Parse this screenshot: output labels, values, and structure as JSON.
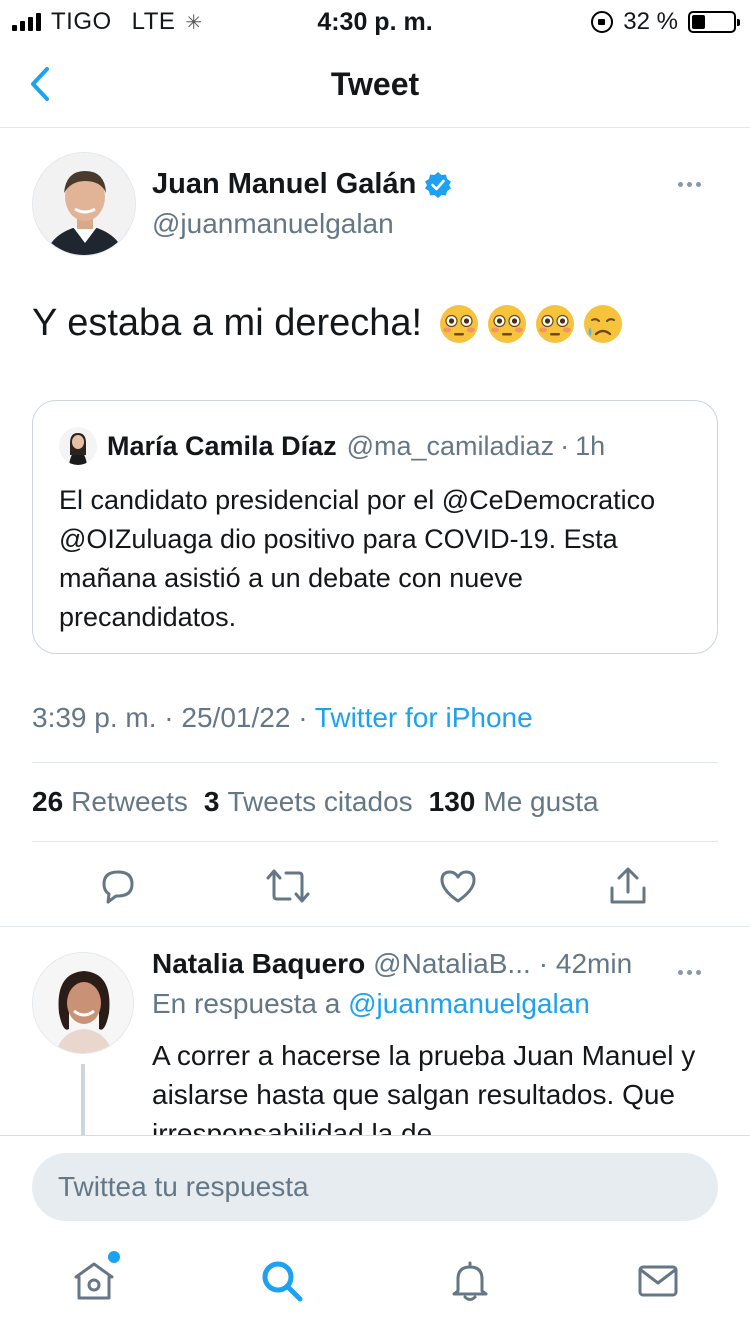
{
  "status_bar": {
    "carrier": "TIGO",
    "network": "LTE",
    "time": "4:30 p. m.",
    "battery": "32 %",
    "battery_level": 0.32
  },
  "nav": {
    "title": "Tweet",
    "back_icon": "chevron-left-icon"
  },
  "tweet": {
    "author_name": "Juan Manuel Galán",
    "author_handle": "@juanmanuelgalan",
    "verified": true,
    "text": "Y estaba a mi derecha!",
    "emojis": [
      "flushed-face",
      "flushed-face",
      "flushed-face",
      "sad-sweat-face"
    ],
    "quoted": {
      "name": "María Camila Díaz",
      "handle": "@ma_camiladiaz",
      "separator": "·",
      "time": "1h",
      "text": "El candidato presidencial por el @CeDemocratico @OIZuluaga  dio positivo para COVID-19. Esta mañana asistió a un debate con nueve precandidatos."
    },
    "time": "3:39 p. m.",
    "date": "25/01/22",
    "separator": "·",
    "source": "Twitter for iPhone",
    "stats": {
      "retweets_count": "26",
      "retweets_label": "Retweets",
      "quotes_count": "3",
      "quotes_label": "Tweets citados",
      "likes_count": "130",
      "likes_label": "Me gusta"
    }
  },
  "reply": {
    "name": "Natalia Baquero",
    "handle": "@NataliaB...",
    "time": "· 42min",
    "reply_to_prefix": "En respuesta a",
    "reply_to_handle": "@juanmanuelgalan",
    "text": "A correr a hacerse la prueba Juan Manuel y aislarse hasta que salgan resultados. Que irresponsabilidad la de"
  },
  "compose": {
    "placeholder": "Twittea tu respuesta"
  },
  "colors": {
    "accent": "#1da1f2",
    "secondary_text": "#657786",
    "divider": "#e1e8ed"
  }
}
